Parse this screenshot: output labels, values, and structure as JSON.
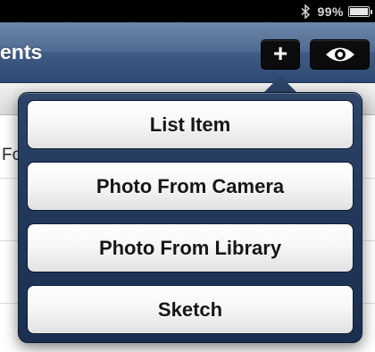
{
  "status_bar": {
    "bluetooth_icon": "bluetooth-icon",
    "battery_percent": "99%",
    "battery_level": 0.99,
    "battery_icon": "battery-icon"
  },
  "nav": {
    "title": "ents",
    "add_icon_glyph": "+",
    "add_icon": "plus-icon",
    "view_icon": "eye-icon"
  },
  "background": {
    "row_text": "Fou"
  },
  "popover": {
    "items": [
      {
        "label": "List Item"
      },
      {
        "label": "Photo From Camera"
      },
      {
        "label": "Photo From Library"
      },
      {
        "label": "Sketch"
      }
    ]
  },
  "colors": {
    "nav_bar": "#4f6b92",
    "popover_background": "#233a5d",
    "button_face": "#f7f7f7",
    "nav_button": "#0c0c0c"
  }
}
